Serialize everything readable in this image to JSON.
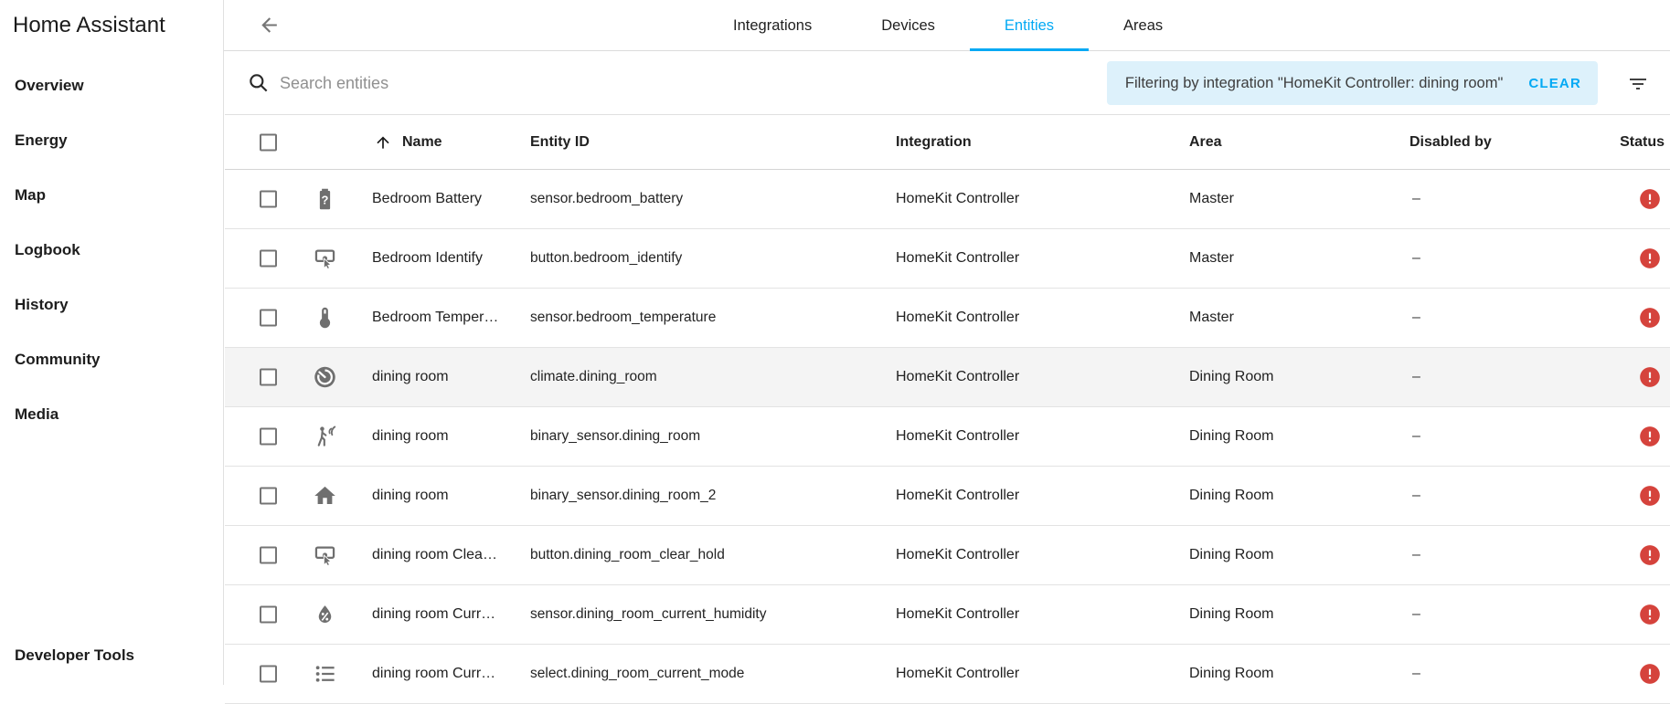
{
  "app": {
    "title": "Home Assistant"
  },
  "colors": {
    "accent": "#03a9f4",
    "error": "#d5433c",
    "chip_bg": "#ddf1fb",
    "highlight": "#f4f4f4"
  },
  "sidebar": {
    "items": [
      "Overview",
      "Energy",
      "Map",
      "Logbook",
      "History",
      "Community",
      "Media"
    ],
    "footer_item": "Developer Tools"
  },
  "tabs": [
    {
      "label": "Integrations",
      "active": false
    },
    {
      "label": "Devices",
      "active": false
    },
    {
      "label": "Entities",
      "active": true
    },
    {
      "label": "Areas",
      "active": false
    }
  ],
  "toolbar": {
    "search_placeholder": "Search entities",
    "filter_text": "Filtering by integration \"HomeKit Controller: dining room\"",
    "clear_label": "CLEAR"
  },
  "icons": {
    "back": "arrow-left-icon",
    "search": "magnify-icon",
    "sort": "arrow-up-icon",
    "filter": "filter-variant-icon",
    "status_error": "alert-circle-icon"
  },
  "table": {
    "headers": {
      "name": "Name",
      "entity_id": "Entity ID",
      "integration": "Integration",
      "area": "Area",
      "disabled_by": "Disabled by",
      "status": "Status"
    },
    "rows": [
      {
        "icon": "battery-unknown-icon",
        "name": "Bedroom Battery",
        "entity_id": "sensor.bedroom_battery",
        "integration": "HomeKit Controller",
        "area": "Master",
        "disabled_by": "–",
        "status": "error",
        "highlighted": false
      },
      {
        "icon": "gesture-tap-icon",
        "name": "Bedroom Identify",
        "entity_id": "button.bedroom_identify",
        "integration": "HomeKit Controller",
        "area": "Master",
        "disabled_by": "–",
        "status": "error",
        "highlighted": false
      },
      {
        "icon": "thermometer-icon",
        "name": "Bedroom Temper…",
        "entity_id": "sensor.bedroom_temperature",
        "integration": "HomeKit Controller",
        "area": "Master",
        "disabled_by": "–",
        "status": "error",
        "highlighted": false
      },
      {
        "icon": "thermostat-icon",
        "name": "dining room",
        "entity_id": "climate.dining_room",
        "integration": "HomeKit Controller",
        "area": "Dining Room",
        "disabled_by": "–",
        "status": "error",
        "highlighted": true
      },
      {
        "icon": "motion-sensor-icon",
        "name": "dining room",
        "entity_id": "binary_sensor.dining_room",
        "integration": "HomeKit Controller",
        "area": "Dining Room",
        "disabled_by": "–",
        "status": "error",
        "highlighted": false
      },
      {
        "icon": "home-icon",
        "name": "dining room",
        "entity_id": "binary_sensor.dining_room_2",
        "integration": "HomeKit Controller",
        "area": "Dining Room",
        "disabled_by": "–",
        "status": "error",
        "highlighted": false
      },
      {
        "icon": "gesture-tap-icon",
        "name": "dining room Clea…",
        "entity_id": "button.dining_room_clear_hold",
        "integration": "HomeKit Controller",
        "area": "Dining Room",
        "disabled_by": "–",
        "status": "error",
        "highlighted": false
      },
      {
        "icon": "water-percent-icon",
        "name": "dining room Curr…",
        "entity_id": "sensor.dining_room_current_humidity",
        "integration": "HomeKit Controller",
        "area": "Dining Room",
        "disabled_by": "–",
        "status": "error",
        "highlighted": false
      },
      {
        "icon": "list-bulleted-icon",
        "name": "dining room Curr…",
        "entity_id": "select.dining_room_current_mode",
        "integration": "HomeKit Controller",
        "area": "Dining Room",
        "disabled_by": "–",
        "status": "error",
        "highlighted": false
      }
    ]
  }
}
